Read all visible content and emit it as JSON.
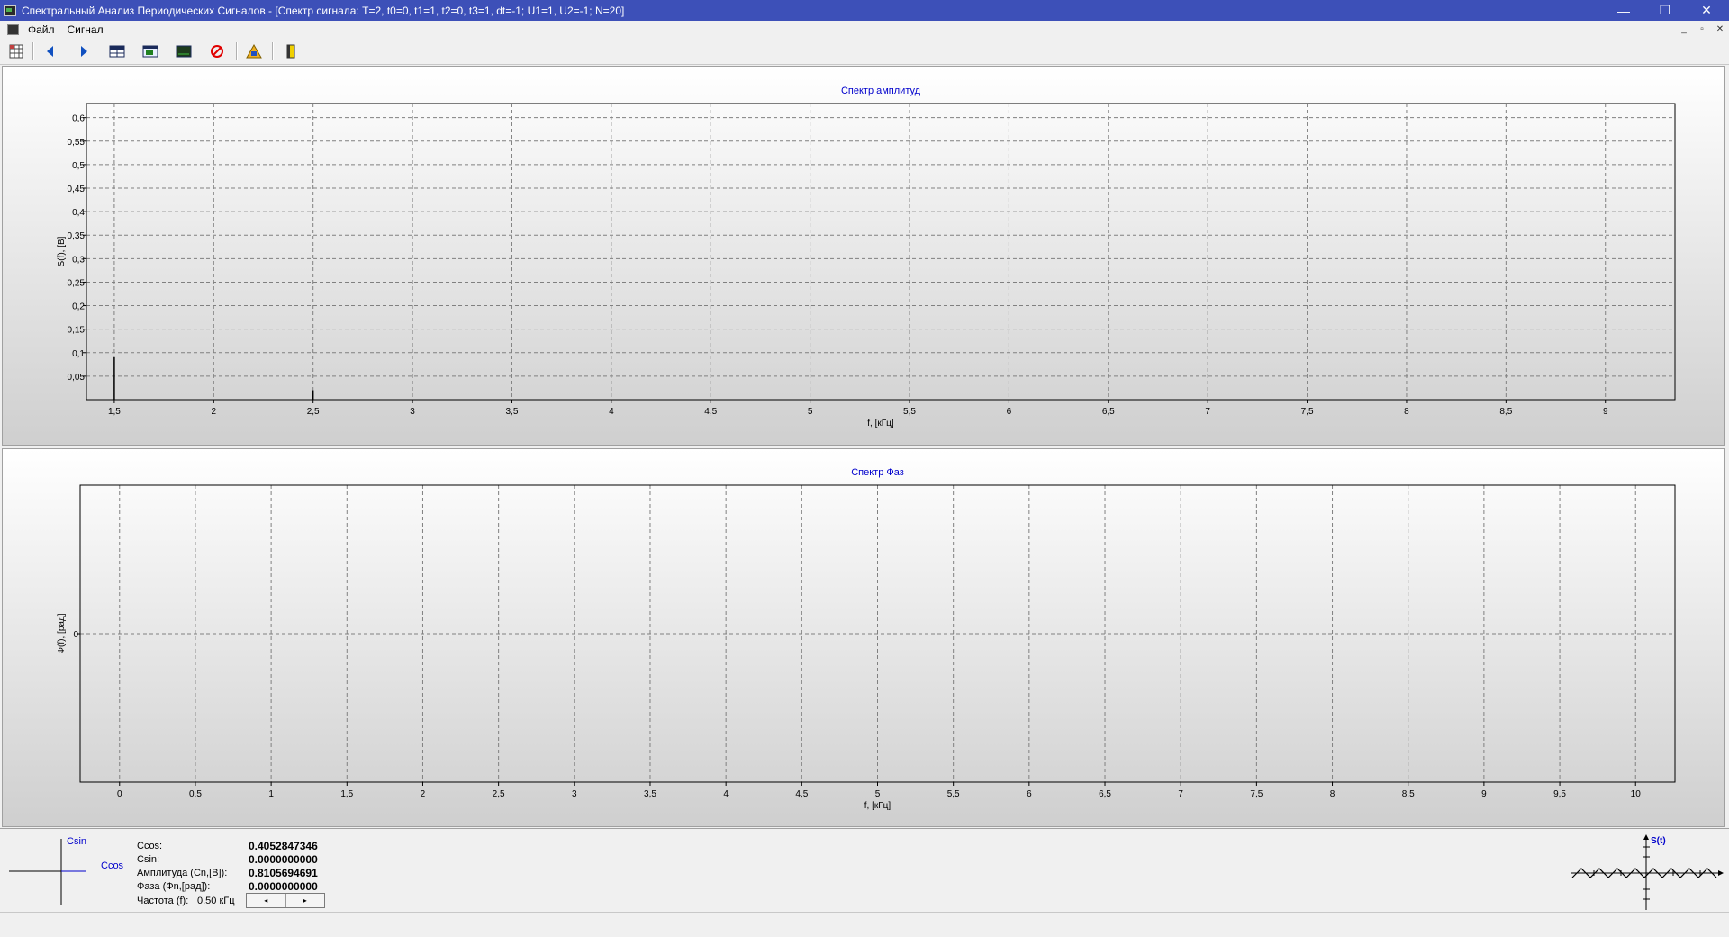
{
  "window": {
    "title": "Спектральный Анализ Периодических Сигналов - [Спектр сигнала: T=2, t0=0, t1=1, t2=0, t3=1, dt=-1; U1=1, U2=-1; N=20]",
    "minimize": "—",
    "maximize": "❐",
    "close": "✕"
  },
  "menu": {
    "file": "Файл",
    "signal": "Сигнал",
    "child_minimize": "_",
    "child_restore": "▫",
    "child_close": "✕"
  },
  "toolbar": {
    "icons": [
      "table-grid-icon",
      "arrow-left-icon",
      "arrow-right-icon",
      "table-icon",
      "signal-window-icon",
      "screen-icon",
      "stop-icon",
      "warning-bell-icon",
      "exit-door-icon"
    ]
  },
  "colors": {
    "title_bar": "#3d50b8",
    "chart_title": "#0000cc",
    "grid": "#808080",
    "stop": "#e00000",
    "arrow": "#1050c0"
  },
  "chart_data": [
    {
      "type": "bar",
      "title": "Спектр амплитуд",
      "xlabel": "f, [кГц]",
      "ylabel": "S(f), [В]",
      "xlim": [
        1.36,
        9.35
      ],
      "ylim": [
        0,
        0.63
      ],
      "xticks": [
        "1,5",
        "2",
        "2,5",
        "3",
        "3,5",
        "4",
        "4,5",
        "5",
        "5,5",
        "6",
        "6,5",
        "7",
        "7,5",
        "8",
        "8,5",
        "9"
      ],
      "yticks": [
        "0,05",
        "0,1",
        "0,15",
        "0,2",
        "0,25",
        "0,3",
        "0,35",
        "0,4",
        "0,45",
        "0,5",
        "0,55",
        "0,6"
      ],
      "x": [
        1.5,
        2.5
      ],
      "values": [
        0.09,
        0.02
      ],
      "grid": true
    },
    {
      "type": "bar",
      "title": "Спектр Фаз",
      "xlabel": "f, [кГц]",
      "ylabel": "Ф(f), [рад]",
      "xlim": [
        -0.26,
        10.26
      ],
      "ylim": [
        -1,
        1
      ],
      "xticks": [
        "0",
        "0,5",
        "1",
        "1,5",
        "2",
        "2,5",
        "3",
        "3,5",
        "4",
        "4,5",
        "5",
        "5,5",
        "6",
        "6,5",
        "7",
        "7,5",
        "8",
        "8,5",
        "9",
        "9,5",
        "10"
      ],
      "yticks": [
        "0"
      ],
      "x": [],
      "values": [],
      "grid": true
    }
  ],
  "vector_diagram": {
    "csin_label": "Csin",
    "ccos_label": "Ccos"
  },
  "info": {
    "ccos_label": "Ccos:",
    "ccos_value": "0.4052847346",
    "csin_label": "Csin:",
    "csin_value": "0.0000000000",
    "amplitude_label": "Амплитуда (Cn,[В]):",
    "amplitude_value": "0.8105694691",
    "phase_label": "Фаза (Фn,[рад]):",
    "phase_value": "0.0000000000",
    "frequency_label": "Частота (f):",
    "frequency_value": "0.50 кГц",
    "scroll_left": "◂",
    "scroll_right": "▸"
  },
  "signal_preview": {
    "axis_label": "S(t)"
  }
}
